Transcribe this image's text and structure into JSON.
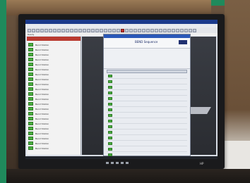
{
  "window": {
    "title": ""
  },
  "menu": [
    "File",
    "Edit",
    "View",
    "Machine",
    "Program",
    "Tools",
    "Window",
    "Help"
  ],
  "status": "Ready",
  "left_panel": {
    "items_count": 22,
    "item_label": "Bend Station"
  },
  "dialog": {
    "header_label": "BEND Sequence",
    "rows_count": 18
  },
  "brand": "HP"
}
